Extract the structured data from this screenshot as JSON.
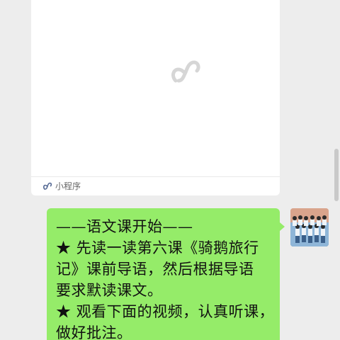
{
  "mini_program_card": {
    "placeholder_icon": "mini-program-link-icon",
    "footer_icon": "mini-program-icon",
    "footer_label": "小程序"
  },
  "message": {
    "lines": [
      "——语文课开始——",
      "★ 先读一读第六课《骑鹅旅行",
      "记》课前导语，然后根据导语",
      "要求默读课文。",
      "★ 观看下面的视频，认真听课，",
      "做好批注。"
    ]
  },
  "avatar": {
    "icon": "group-photo-avatar"
  },
  "colors": {
    "background": "#ededed",
    "bubble": "#95ec69",
    "card": "#ffffff"
  }
}
